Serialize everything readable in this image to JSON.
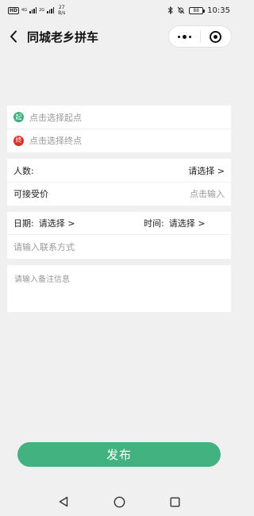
{
  "status_bar": {
    "hd_label": "HD",
    "network1": "4G",
    "network2": "2G",
    "net_speed_value": "27",
    "net_speed_unit": "B/s",
    "battery": "88",
    "time": "10:35"
  },
  "nav": {
    "title": "同城老乡拼车"
  },
  "route": {
    "start_badge": "起",
    "start_placeholder": "点击选择起点",
    "end_badge": "终",
    "end_placeholder": "点击选择终点"
  },
  "info": {
    "people_label": "人数:",
    "people_value": "请选择 >",
    "price_label": "可接受价",
    "price_placeholder": "点击输入"
  },
  "schedule": {
    "date_label": "日期:",
    "date_value": "请选择 >",
    "time_label": "时间:",
    "time_value": "请选择 >",
    "contact_placeholder": "请输入联系方式"
  },
  "remark": {
    "placeholder": "请输入备注信息"
  },
  "publish_label": "发布",
  "colors": {
    "accent": "#42b281",
    "start_badge": "#3fae7a",
    "end_badge": "#d9302c",
    "background": "#f0f0f0"
  },
  "icons": {
    "back": "chevron-left-icon",
    "more": "more-dots-icon",
    "close": "target-circle-icon",
    "bluetooth": "bluetooth-icon",
    "mute": "bell-off-icon",
    "sys_back": "triangle-back-icon",
    "sys_home": "circle-home-icon",
    "sys_recent": "square-recent-icon"
  }
}
